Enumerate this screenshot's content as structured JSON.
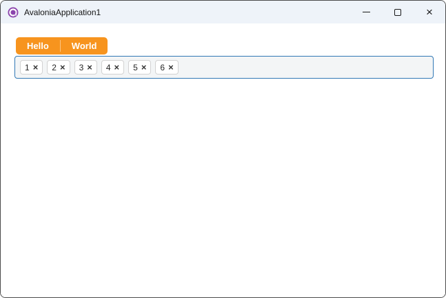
{
  "window": {
    "title": "AvaloniaApplication1",
    "controls": {
      "minimize_icon": "minimize-line",
      "maximize_icon": "square-outline",
      "close_glyph": "×"
    }
  },
  "toolbar": {
    "buttons": [
      {
        "label": "Hello"
      },
      {
        "label": "World"
      }
    ]
  },
  "chips": {
    "remove_glyph": "×",
    "items": [
      {
        "label": "1"
      },
      {
        "label": "2"
      },
      {
        "label": "3"
      },
      {
        "label": "4"
      },
      {
        "label": "5"
      },
      {
        "label": "6"
      }
    ]
  },
  "colors": {
    "accent_orange": "#F7941E",
    "focus_border_blue": "#3178B5",
    "titlebar_bg": "#EEF3F9",
    "chipbox_bg": "#F3F5F6",
    "logo_purple": "#8B44AC"
  }
}
